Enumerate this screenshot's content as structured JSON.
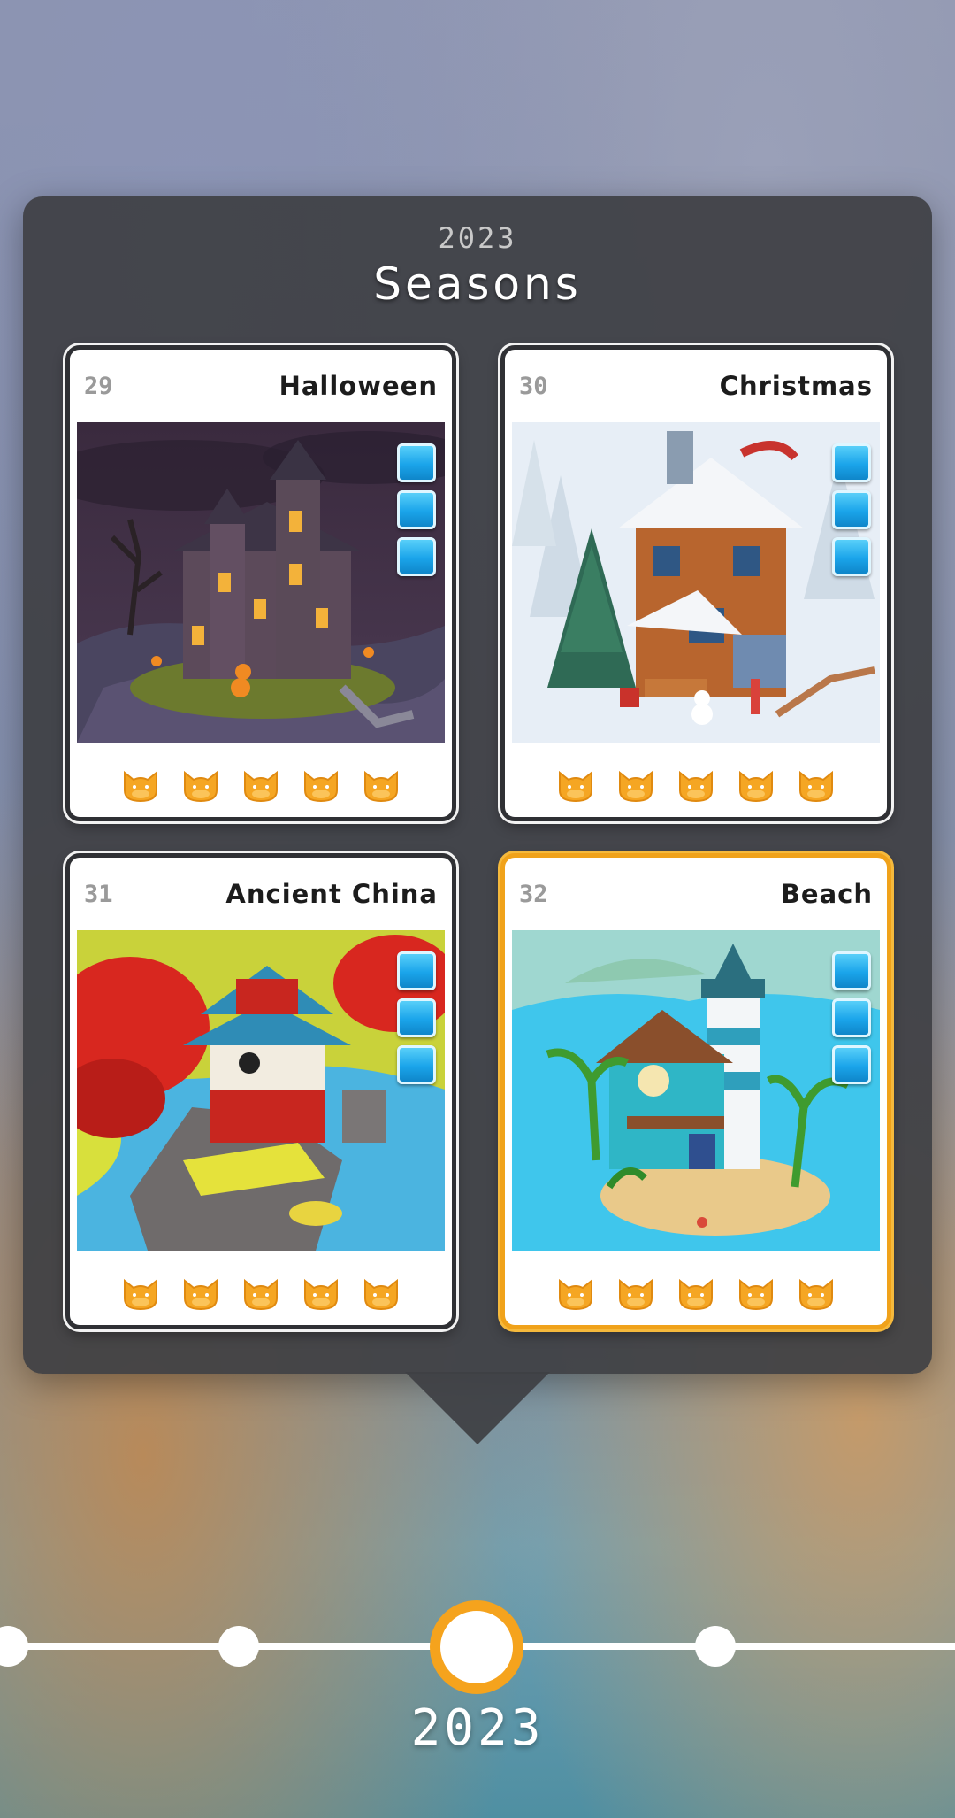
{
  "panel": {
    "year": "2023",
    "title": "Seasons"
  },
  "cards": [
    {
      "number": "29",
      "name": "Halloween",
      "progress_squares": 3,
      "cat_icons": 5,
      "image": "haunted-mansion-scene",
      "selected": false
    },
    {
      "number": "30",
      "name": "Christmas",
      "progress_squares": 3,
      "cat_icons": 5,
      "image": "snowy-cabin-scene",
      "selected": false
    },
    {
      "number": "31",
      "name": "Ancient China",
      "progress_squares": 3,
      "cat_icons": 5,
      "image": "chinese-pagoda-scene",
      "selected": false
    },
    {
      "number": "32",
      "name": "Beach",
      "progress_squares": 3,
      "cat_icons": 5,
      "image": "beach-lighthouse-scene",
      "selected": true
    }
  ],
  "timeline": {
    "current_label": "2023"
  },
  "colors": {
    "accent": "#f5a31d",
    "panel": "#3e4044",
    "square": "#1aa4ea",
    "cat": "#f5a623"
  }
}
